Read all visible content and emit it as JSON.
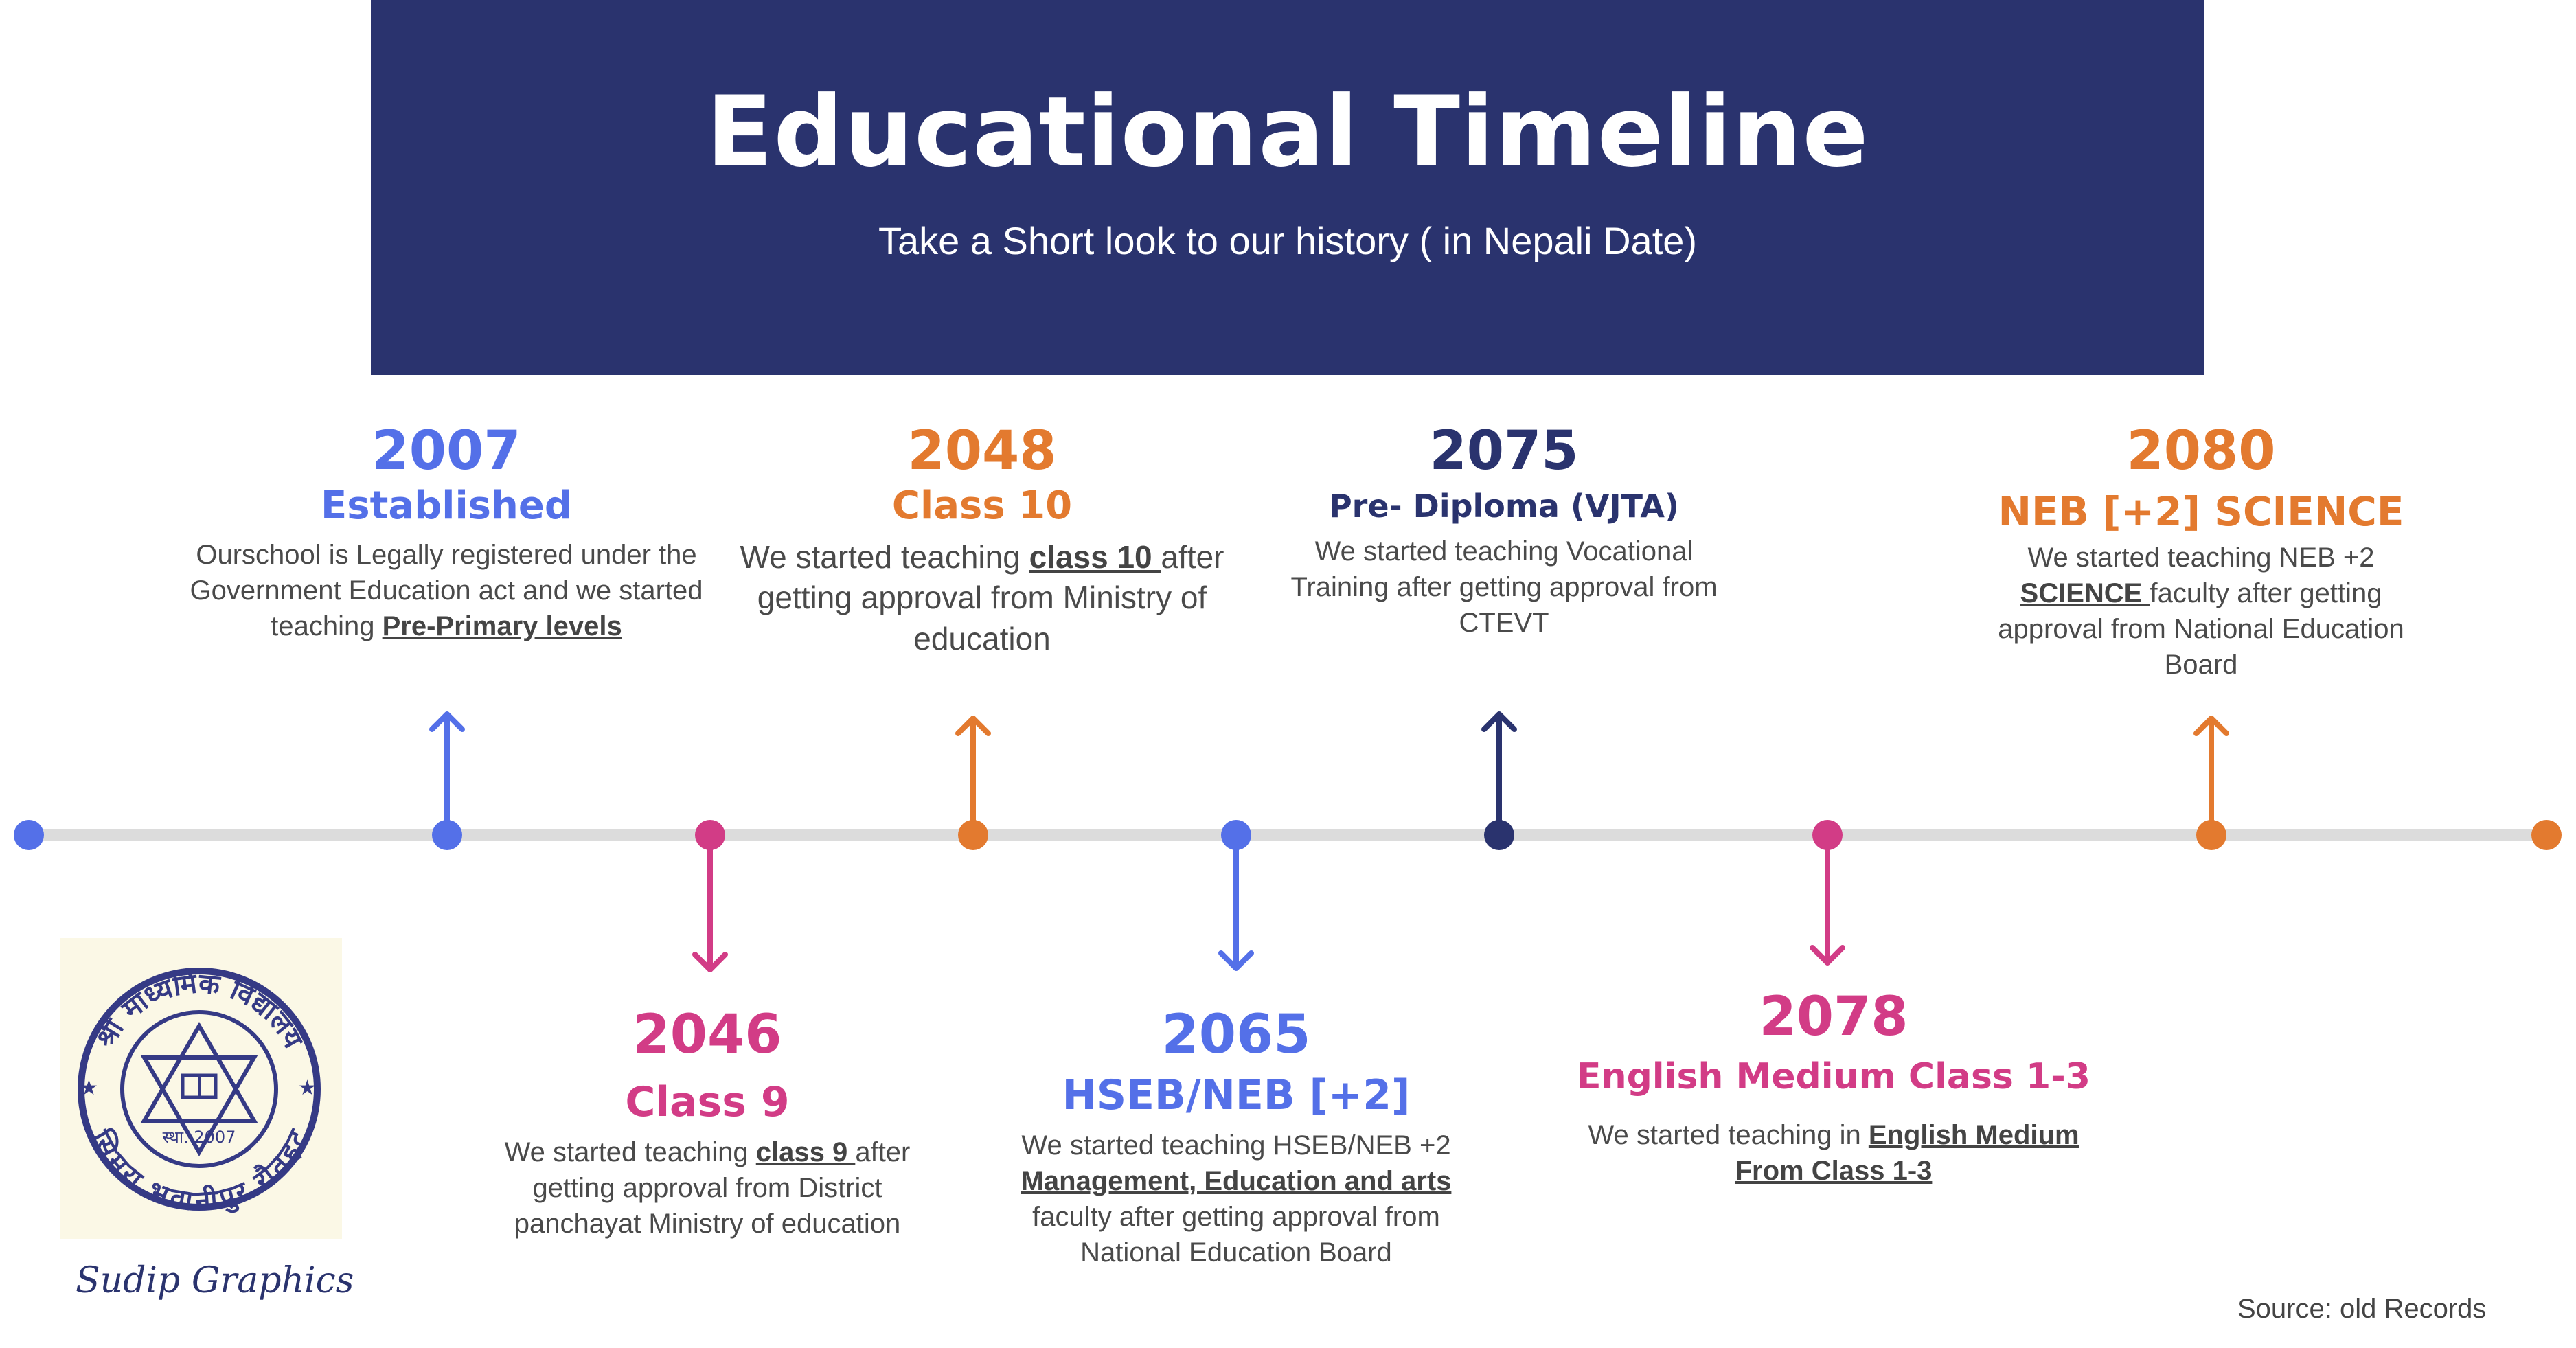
{
  "header": {
    "title": "Educational Timeline",
    "subtitle": "Take a Short look to our history ( in Nepali Date)"
  },
  "colors": {
    "header_bg": "#2a336e",
    "blue": "#5470e8",
    "orange": "#e37a2f",
    "pink": "#d23c86",
    "navy": "#2a336e",
    "line": "#dcdcdc"
  },
  "events": [
    {
      "year": "2007",
      "title": "Established",
      "color": "#5470e8",
      "desc": [
        "Ourschool is Legally registered under the Government  Education act and we started teaching ",
        {
          "u": "Pre-Primary levels"
        }
      ]
    },
    {
      "year": "2046",
      "title": "Class 9",
      "color": "#d23c86",
      "desc": [
        "We started teaching ",
        {
          "u": "class 9 "
        },
        " after getting approval from District panchayat Ministry of education"
      ]
    },
    {
      "year": "2048",
      "title": "Class 10",
      "color": "#e37a2f",
      "desc": [
        "We started teaching ",
        {
          "u": "class 10 "
        },
        " after getting approval from  Ministry of education"
      ]
    },
    {
      "year": "2065",
      "title": "HSEB/NEB [+2]",
      "color": "#5470e8",
      "desc": [
        "We started teaching HSEB/NEB +2 ",
        {
          "u": "Management, Education and arts"
        },
        " faculty after getting approval from National Education Board"
      ]
    },
    {
      "year": "2075",
      "title": "Pre- Diploma (VJTA)",
      "color": "#2a336e",
      "desc": [
        "We started teaching  Vocational Training after getting approval from CTEVT"
      ]
    },
    {
      "year": "2078",
      "title": "English Medium Class 1-3",
      "color": "#d23c86",
      "desc": [
        "We started teaching in ",
        {
          "u": "English Medium From Class 1-3 "
        }
      ]
    },
    {
      "year": "2080",
      "title": "NEB [+2] SCIENCE",
      "color": "#e37a2f",
      "desc": [
        "We started teaching NEB +2 ",
        {
          "u": "SCIENCE "
        },
        "faculty after getting approval from National Education Board"
      ]
    }
  ],
  "logo": {
    "alt": "school-seal",
    "top_text": "श्री माध्यमिक विद्यालय",
    "bottom_text": "सिमरा भवानीपुर रौतहट",
    "estd": "स्था. 2007"
  },
  "signature": "Sudip Graphics",
  "source": "Source: old Records"
}
